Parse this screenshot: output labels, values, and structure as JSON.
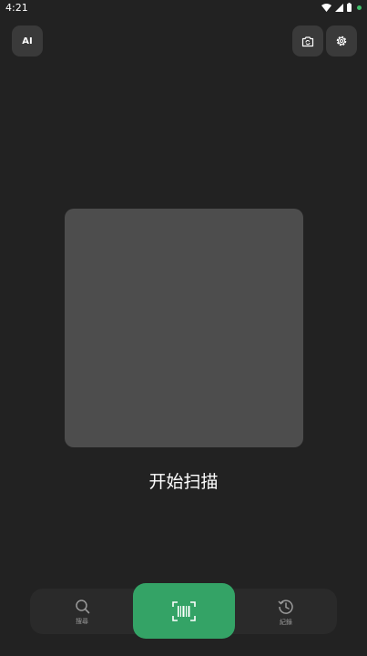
{
  "status_bar": {
    "time": "4:21"
  },
  "top_bar": {
    "ai_label": "AI",
    "camera_icon": "camera-rotate-icon",
    "settings_icon": "gear-icon"
  },
  "scan": {
    "title": "开始扫描"
  },
  "bottom_nav": {
    "search_label": "搜尋",
    "history_label": "紀錄",
    "scan_icon": "barcode-scan-icon"
  },
  "colors": {
    "background": "#222222",
    "button": "#3a3a3a",
    "scan_frame": "#4d4d4d",
    "accent": "#34a366",
    "nav_bar": "#2a2a2a"
  }
}
